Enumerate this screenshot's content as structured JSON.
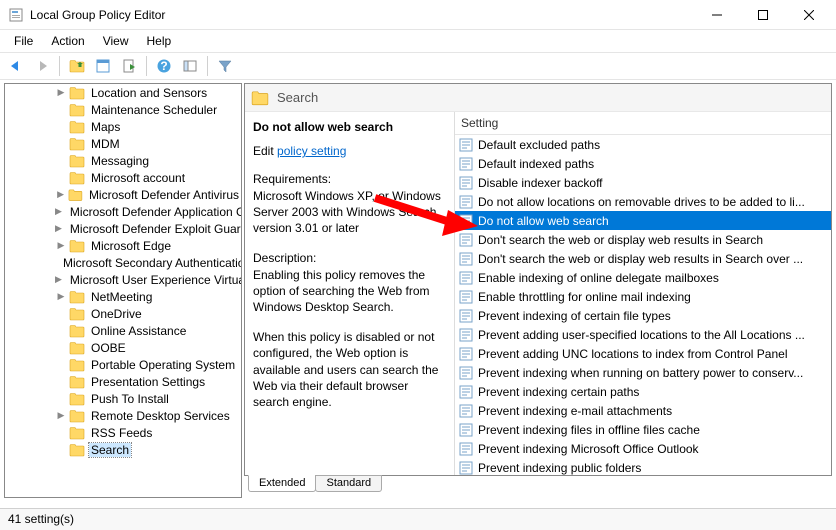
{
  "window": {
    "title": "Local Group Policy Editor"
  },
  "menus": [
    "File",
    "Action",
    "View",
    "Help"
  ],
  "toolbar_icons": [
    "back",
    "forward",
    "up",
    "properties",
    "export",
    "help",
    "show-hide",
    "filter"
  ],
  "tree_items": [
    {
      "label": "Location and Sensors",
      "expandable": true
    },
    {
      "label": "Maintenance Scheduler",
      "expandable": false
    },
    {
      "label": "Maps",
      "expandable": false
    },
    {
      "label": "MDM",
      "expandable": false
    },
    {
      "label": "Messaging",
      "expandable": false
    },
    {
      "label": "Microsoft account",
      "expandable": false
    },
    {
      "label": "Microsoft Defender Antivirus",
      "expandable": true
    },
    {
      "label": "Microsoft Defender Application Guard",
      "expandable": true
    },
    {
      "label": "Microsoft Defender Exploit Guard",
      "expandable": true
    },
    {
      "label": "Microsoft Edge",
      "expandable": true
    },
    {
      "label": "Microsoft Secondary Authentication Factor",
      "expandable": false
    },
    {
      "label": "Microsoft User Experience Virtualization",
      "expandable": true
    },
    {
      "label": "NetMeeting",
      "expandable": true
    },
    {
      "label": "OneDrive",
      "expandable": false
    },
    {
      "label": "Online Assistance",
      "expandable": false
    },
    {
      "label": "OOBE",
      "expandable": false
    },
    {
      "label": "Portable Operating System",
      "expandable": false
    },
    {
      "label": "Presentation Settings",
      "expandable": false
    },
    {
      "label": "Push To Install",
      "expandable": false
    },
    {
      "label": "Remote Desktop Services",
      "expandable": true
    },
    {
      "label": "RSS Feeds",
      "expandable": false
    },
    {
      "label": "Search",
      "expandable": false,
      "selected": true
    }
  ],
  "header_band": "Search",
  "desc": {
    "policy_name": "Do not allow web search",
    "edit_prefix": "Edit ",
    "edit_link": "policy setting ",
    "req_label": "Requirements:",
    "req_text": "Microsoft Windows XP, or Windows Server 2003 with Windows Search version 3.01 or later",
    "desc_label": "Description:",
    "desc_text1": "Enabling this policy removes the option of searching the Web from Windows Desktop Search.",
    "desc_text2": "When this policy is disabled or not configured, the Web option is available and users can search the Web via their default browser search engine."
  },
  "list_header": "Setting",
  "settings": [
    "Default excluded paths",
    "Default indexed paths",
    "Disable indexer backoff",
    "Do not allow locations on removable drives to be added to li...",
    "Do not allow web search",
    "Don't search the web or display web results in Search",
    "Don't search the web or display web results in Search over ...",
    "Enable indexing of online delegate mailboxes",
    "Enable throttling for online mail indexing",
    "Prevent indexing of certain file types",
    "Prevent adding user-specified locations to the All Locations ...",
    "Prevent adding UNC locations to index from Control Panel",
    "Prevent indexing when running on battery power to conserv...",
    "Prevent indexing certain paths",
    "Prevent indexing e-mail attachments",
    "Prevent indexing files in offline files cache",
    "Prevent indexing Microsoft Office Outlook",
    "Prevent indexing public folders"
  ],
  "selected_setting_index": 4,
  "tabs": [
    "Extended",
    "Standard"
  ],
  "status": "41 setting(s)"
}
